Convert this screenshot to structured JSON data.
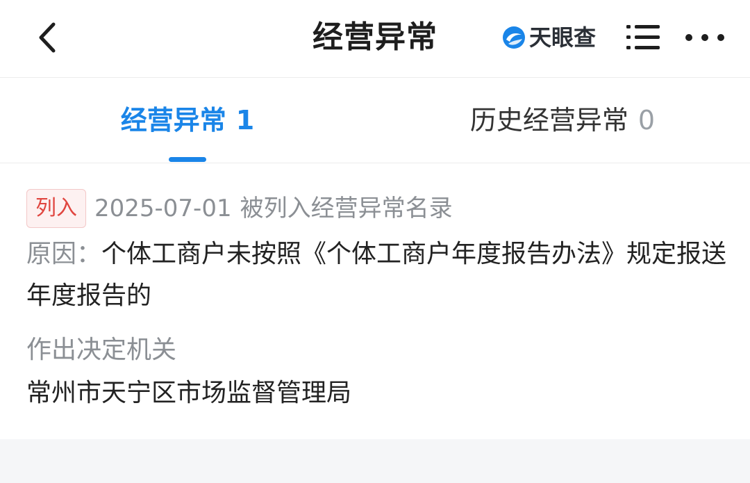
{
  "header": {
    "title": "经营异常",
    "brand_name": "天眼查",
    "icons": [
      "back-arrow-icon",
      "tianyancha-logo-icon",
      "menu-list-icon",
      "more-dots-icon"
    ],
    "accent_color": "#1a85e8"
  },
  "tabs": [
    {
      "label": "经营异常",
      "count": "1",
      "active": true
    },
    {
      "label": "历史经营异常",
      "count": "0",
      "active": false
    }
  ],
  "record": {
    "status": "列入",
    "date": "2025-07-01",
    "description": "被列入经营异常名录",
    "reason_label": "原因：",
    "reason_text": "个体工商户未按照《个体工商户年度报告办法》规定报送年度报告的",
    "authority_label": "作出决定机关",
    "authority_value": "常州市天宁区市场监督管理局",
    "status_color": "#e0453f"
  }
}
